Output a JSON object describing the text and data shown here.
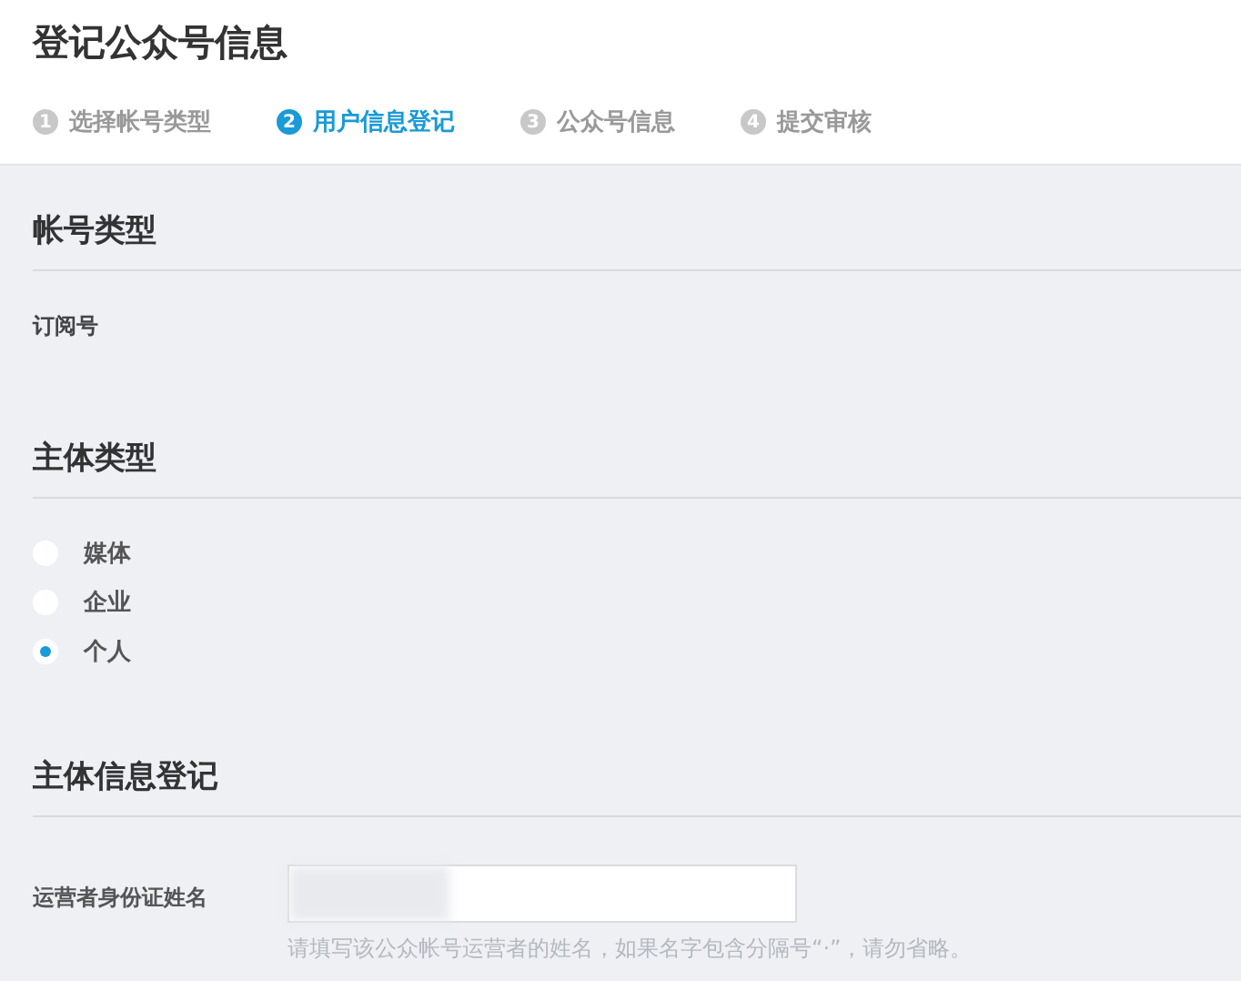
{
  "page_title": "登记公众号信息",
  "steps": [
    {
      "number": "1",
      "label": "选择帐号类型",
      "selected": false
    },
    {
      "number": "2",
      "label": "用户信息登记",
      "selected": true
    },
    {
      "number": "3",
      "label": "公众号信息",
      "selected": false
    },
    {
      "number": "4",
      "label": "提交审核",
      "selected": false
    }
  ],
  "account_type": {
    "heading": "帐号类型",
    "value": "订阅号"
  },
  "subject_type": {
    "heading": "主体类型",
    "options": [
      {
        "label": "媒体",
        "selected": false
      },
      {
        "label": "企业",
        "selected": false
      },
      {
        "label": "个人",
        "selected": true
      }
    ]
  },
  "subject_info": {
    "heading": "主体信息登记",
    "field": {
      "label": "运营者身份证姓名",
      "hint": "请填写该公众帐号运营者的姓名，如果名字包含分隔号“·”，请勿省略。"
    }
  }
}
